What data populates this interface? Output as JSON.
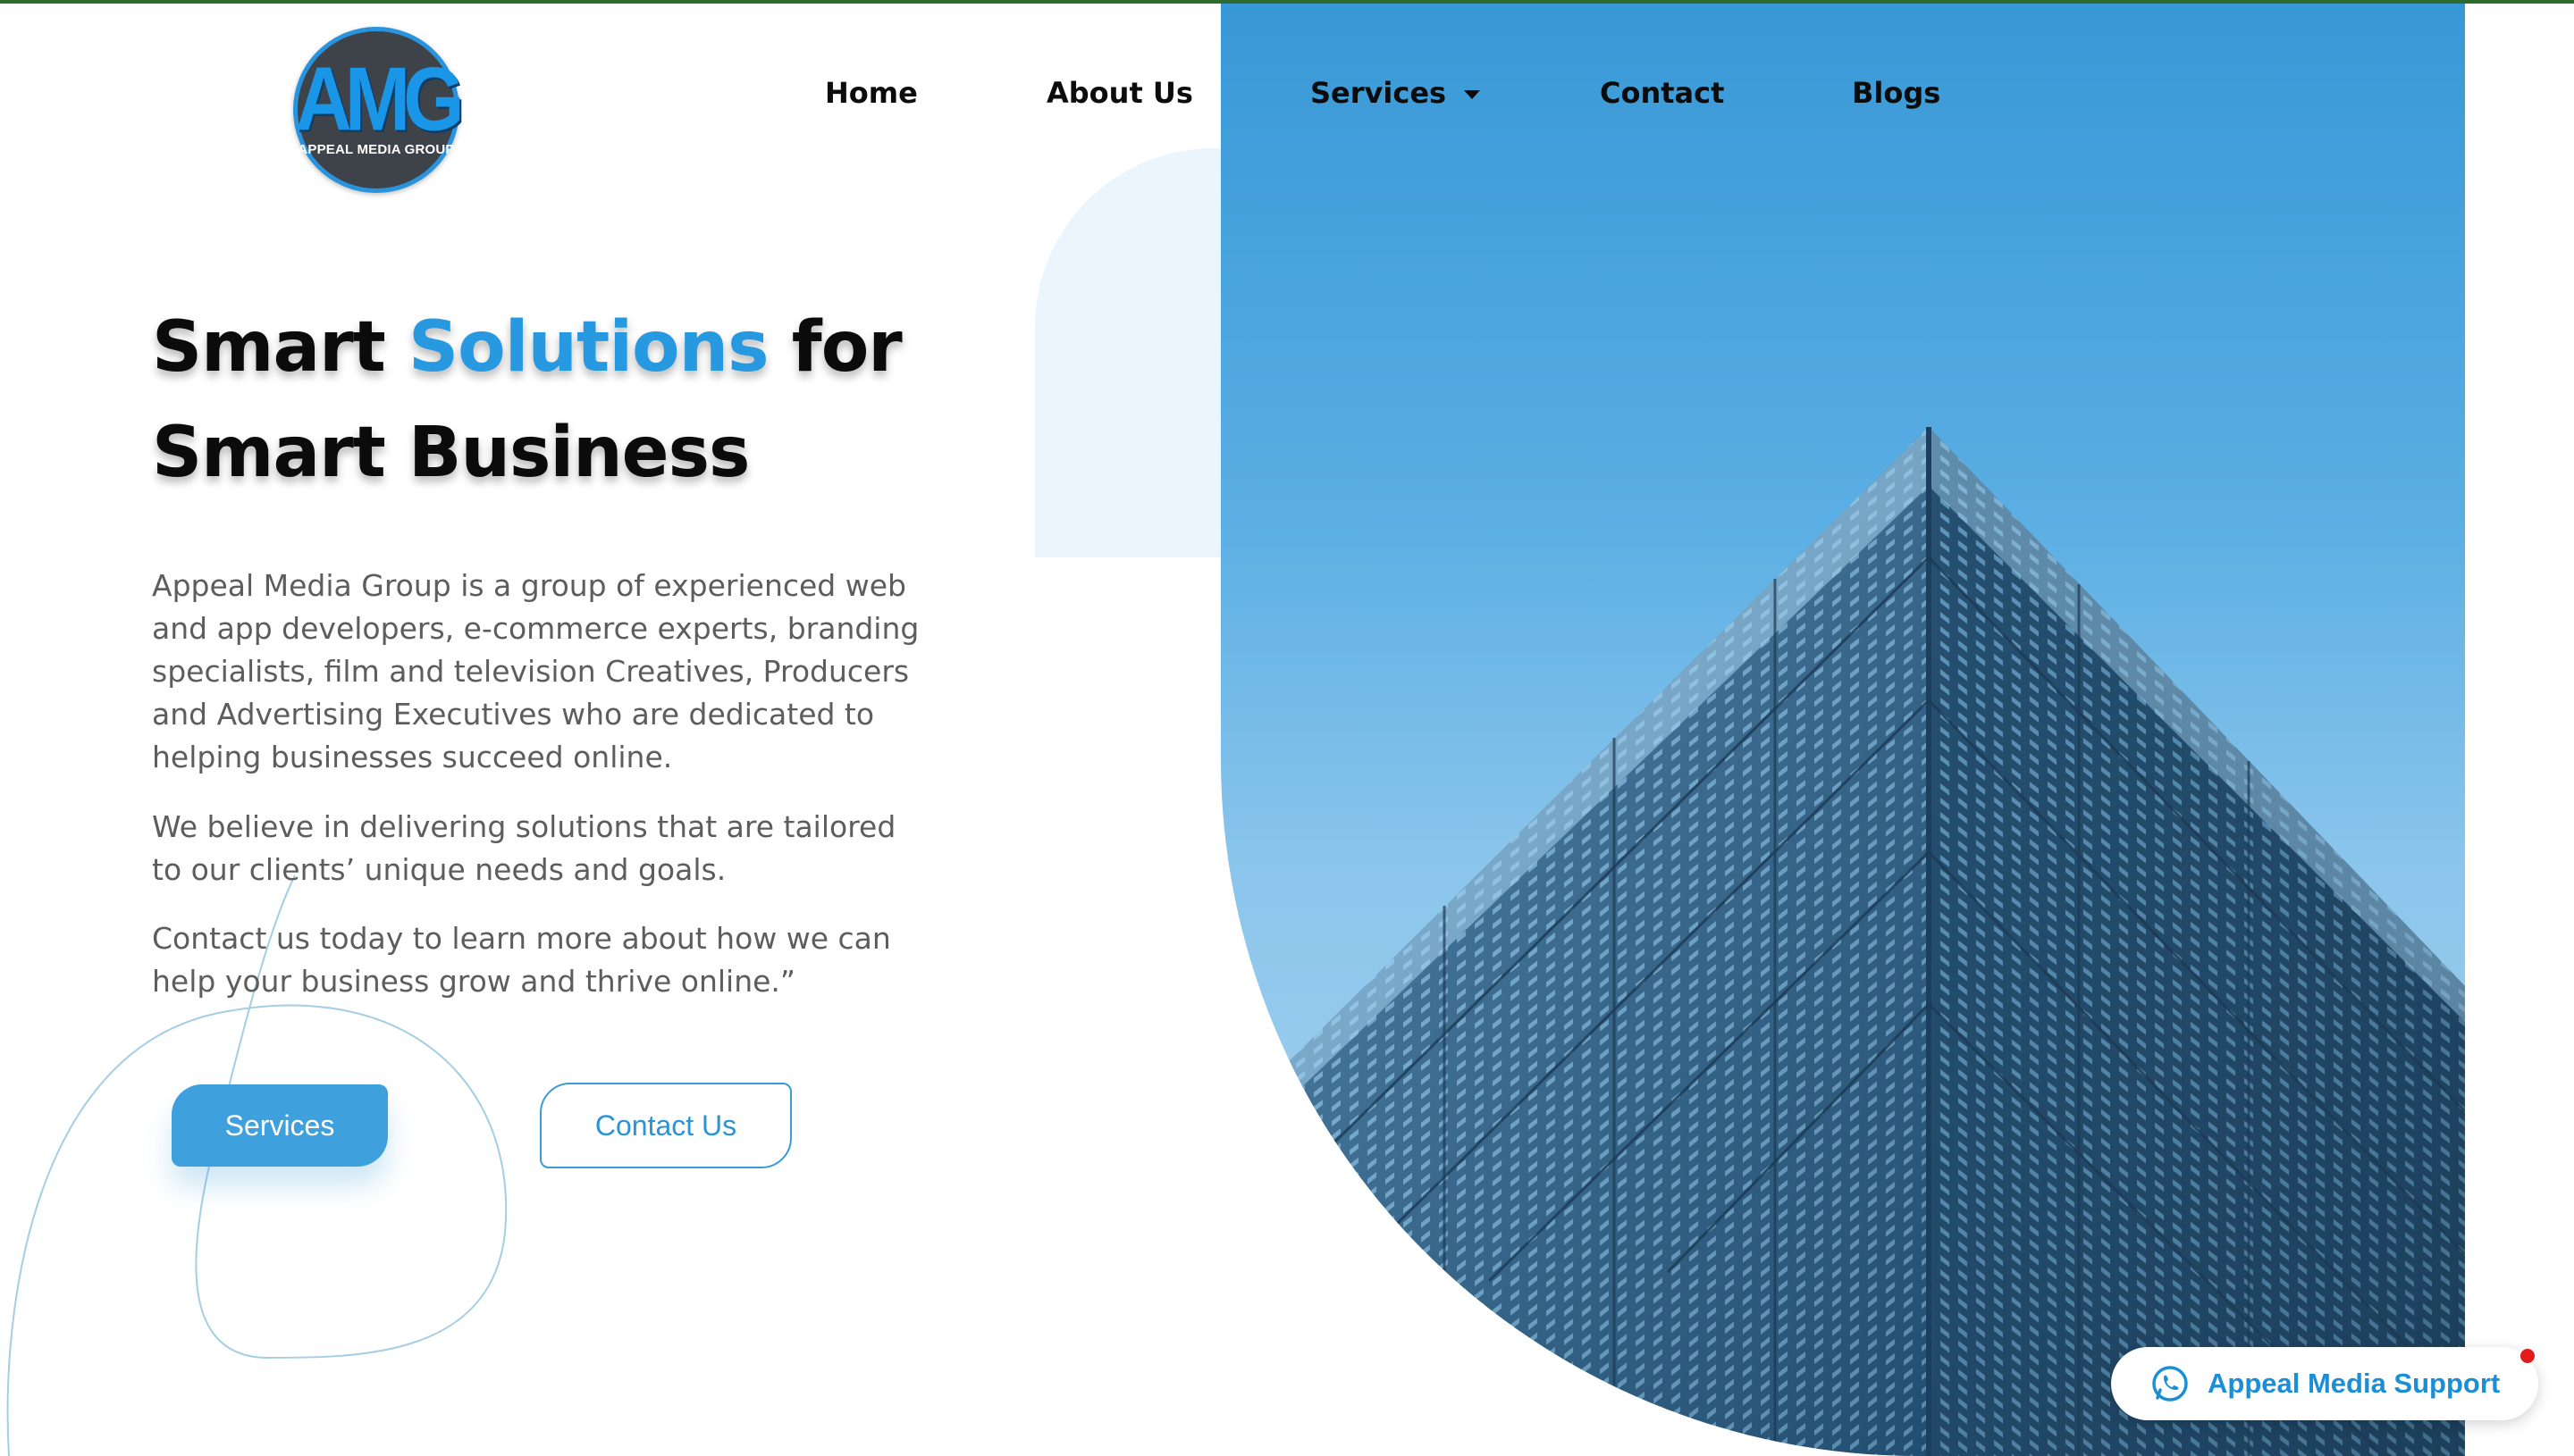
{
  "brand": {
    "logo_mark": "AMG",
    "logo_text": "APPEAL MEDIA GROUP",
    "accent_color": "#2799e0",
    "logo_ring_color": "#2a93dd"
  },
  "nav": {
    "items": [
      {
        "label": "Home"
      },
      {
        "label": "About Us"
      },
      {
        "label": "Services",
        "has_dropdown": true
      },
      {
        "label": "Contact"
      },
      {
        "label": "Blogs"
      }
    ]
  },
  "hero": {
    "headline_part1": "Smart ",
    "headline_accent": "Solutions",
    "headline_part2": " for",
    "headline_line2": "Smart Business",
    "paragraphs": [
      "Appeal Media Group is a group of experienced web and app developers, e-commerce experts, branding specialists, film and television Creatives, Producers and Advertising Executives who are dedicated to helping businesses succeed online.",
      "We believe in delivering solutions that are tailored to our clients’ unique needs and goals.",
      "Contact us today to learn more about how we can help your business grow and thrive online.”"
    ],
    "primary_button": "Services",
    "secondary_button": "Contact Us"
  },
  "support_widget": {
    "label": "Appeal Media Support",
    "icon": "whatsapp-icon",
    "has_notification": true
  }
}
